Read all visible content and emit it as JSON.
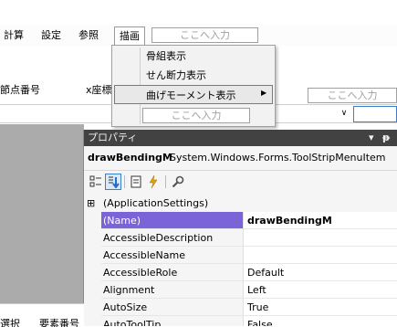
{
  "menu": {
    "items": [
      "計算",
      "設定",
      "参照",
      "描画"
    ],
    "toolbox_placeholder": "ここへ入力"
  },
  "grid": {
    "headers": [
      "節点番号",
      "x座標",
      "",
      "ここへ入力"
    ],
    "combo_arrow": "∨"
  },
  "dropdown": {
    "items": [
      "骨組表示",
      "せん断力表示",
      "曲げモーメント表示"
    ],
    "submenu_arrow": "▶",
    "input_placeholder": "ここへ入力"
  },
  "properties": {
    "title": "プロパティ",
    "title_icons": [
      "▾",
      "ᵽ"
    ],
    "object_name": "drawBendingM",
    "object_type": "System.Windows.Forms.ToolStripMenuItem",
    "rows": [
      {
        "name": "(ApplicationSettings)",
        "value": "",
        "expander": "⊞",
        "selected": false
      },
      {
        "name": "(Name)",
        "value": "drawBendingM",
        "expander": "",
        "selected": true
      },
      {
        "name": "AccessibleDescription",
        "value": "",
        "expander": "",
        "selected": false
      },
      {
        "name": "AccessibleName",
        "value": "",
        "expander": "",
        "selected": false
      },
      {
        "name": "AccessibleRole",
        "value": "Default",
        "expander": "",
        "selected": false
      },
      {
        "name": "Alignment",
        "value": "Left",
        "expander": "",
        "selected": false
      },
      {
        "name": "AutoSize",
        "value": "True",
        "expander": "",
        "selected": false
      },
      {
        "name": "AutoToolTip",
        "value": "False",
        "expander": "",
        "selected": false
      }
    ]
  },
  "bottom": {
    "labels": [
      "選択",
      "要素番号"
    ]
  },
  "colors": {
    "title_bar": "#424242",
    "selection": "#7b63d8",
    "lightning": "#e5a000"
  }
}
